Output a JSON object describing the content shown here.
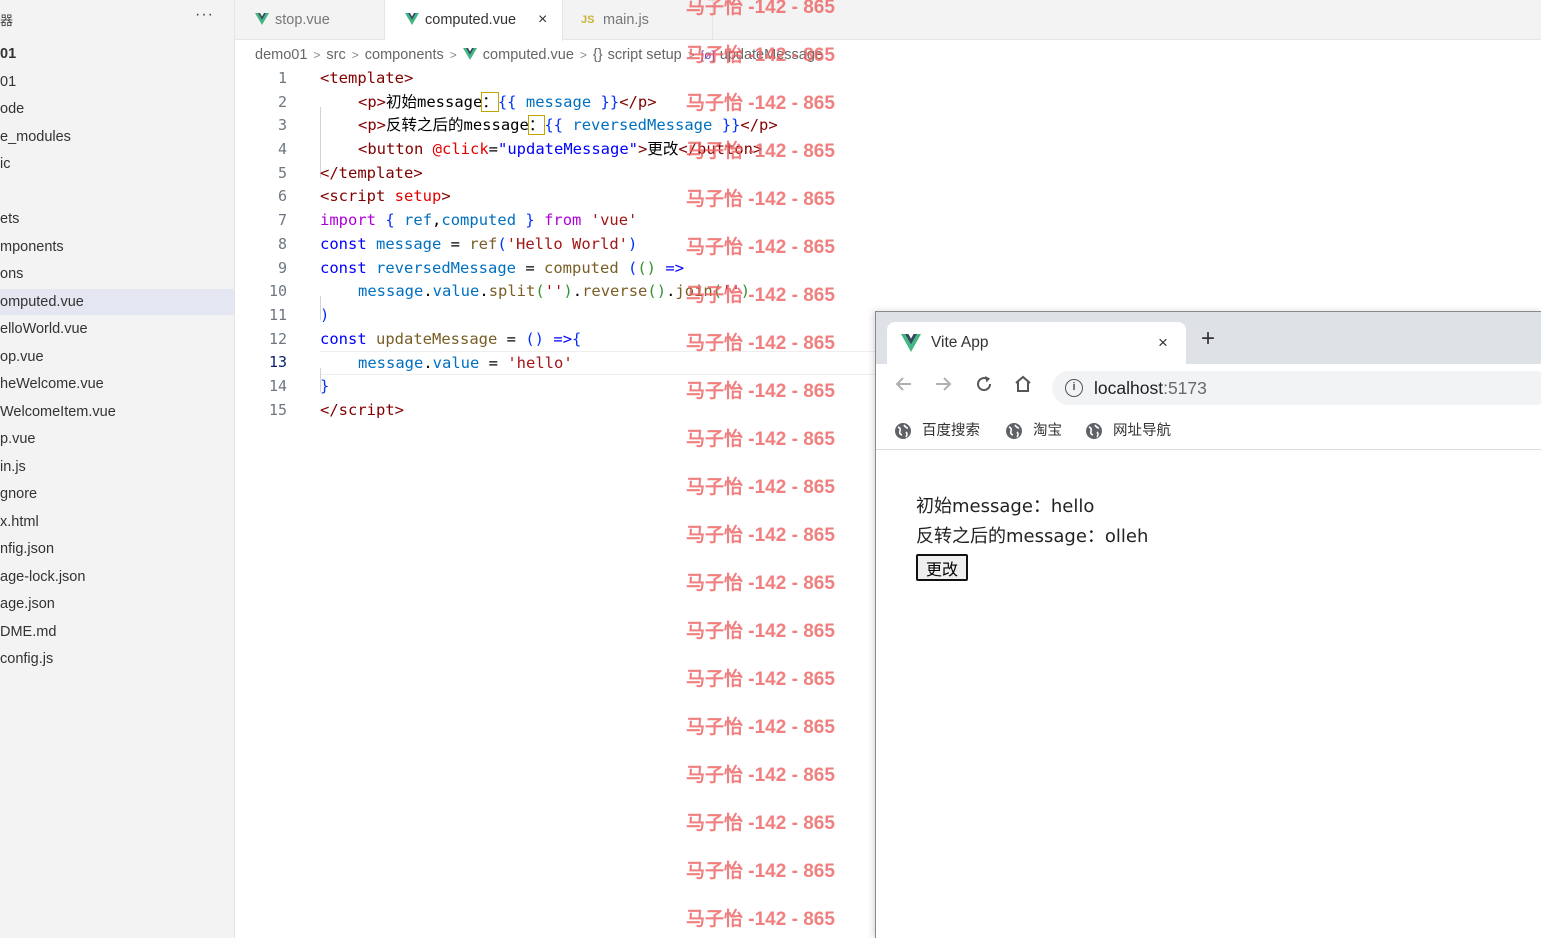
{
  "sidebar": {
    "title": "器",
    "more": "···",
    "items": [
      {
        "label": "01",
        "bold": true
      },
      {
        "label": "01"
      },
      {
        "label": "ode"
      },
      {
        "label": "e_modules"
      },
      {
        "label": "ic"
      },
      {
        "label": ""
      },
      {
        "label": "ets"
      },
      {
        "label": "mponents"
      },
      {
        "label": "ons"
      },
      {
        "label": "omputed.vue",
        "selected": true
      },
      {
        "label": "elloWorld.vue"
      },
      {
        "label": "op.vue"
      },
      {
        "label": "heWelcome.vue"
      },
      {
        "label": "WelcomeItem.vue"
      },
      {
        "label": "p.vue"
      },
      {
        "label": "in.js"
      },
      {
        "label": "gnore"
      },
      {
        "label": "x.html"
      },
      {
        "label": "nfig.json"
      },
      {
        "label": "age-lock.json"
      },
      {
        "label": "age.json"
      },
      {
        "label": "DME.md"
      },
      {
        "label": "config.js"
      }
    ]
  },
  "tabs": {
    "stop": "stop.vue",
    "computed": "computed.vue",
    "main": "main.js",
    "main_icon": "JS",
    "close": "×"
  },
  "breadcrumb": {
    "items": [
      "demo01",
      "src",
      "components",
      "computed.vue",
      "script setup",
      "updateMessage"
    ],
    "script_icon": "{}",
    "method_icon": "[ø]"
  },
  "editor": {
    "line_numbers": [
      "1",
      "2",
      "3",
      "4",
      "5",
      "6",
      "7",
      "8",
      "9",
      "10",
      "11",
      "12",
      "13",
      "14",
      "15"
    ],
    "current_line": 13
  },
  "watermark": "马子怡 -142 - 865",
  "browser": {
    "tab_title": "Vite App",
    "tab_close": "×",
    "new_tab": "+",
    "url_host": "localhost",
    "url_port": ":5173",
    "bookmarks": [
      "百度搜索",
      "淘宝",
      "网址导航"
    ],
    "page": {
      "line1": "初始message：hello",
      "line2": "反转之后的message：olleh",
      "button": "更改"
    }
  },
  "colors": {
    "vue_green": "#41b883",
    "vue_dark": "#35495e",
    "selection": "#e4e6f1",
    "watermark": "#ec6060"
  }
}
